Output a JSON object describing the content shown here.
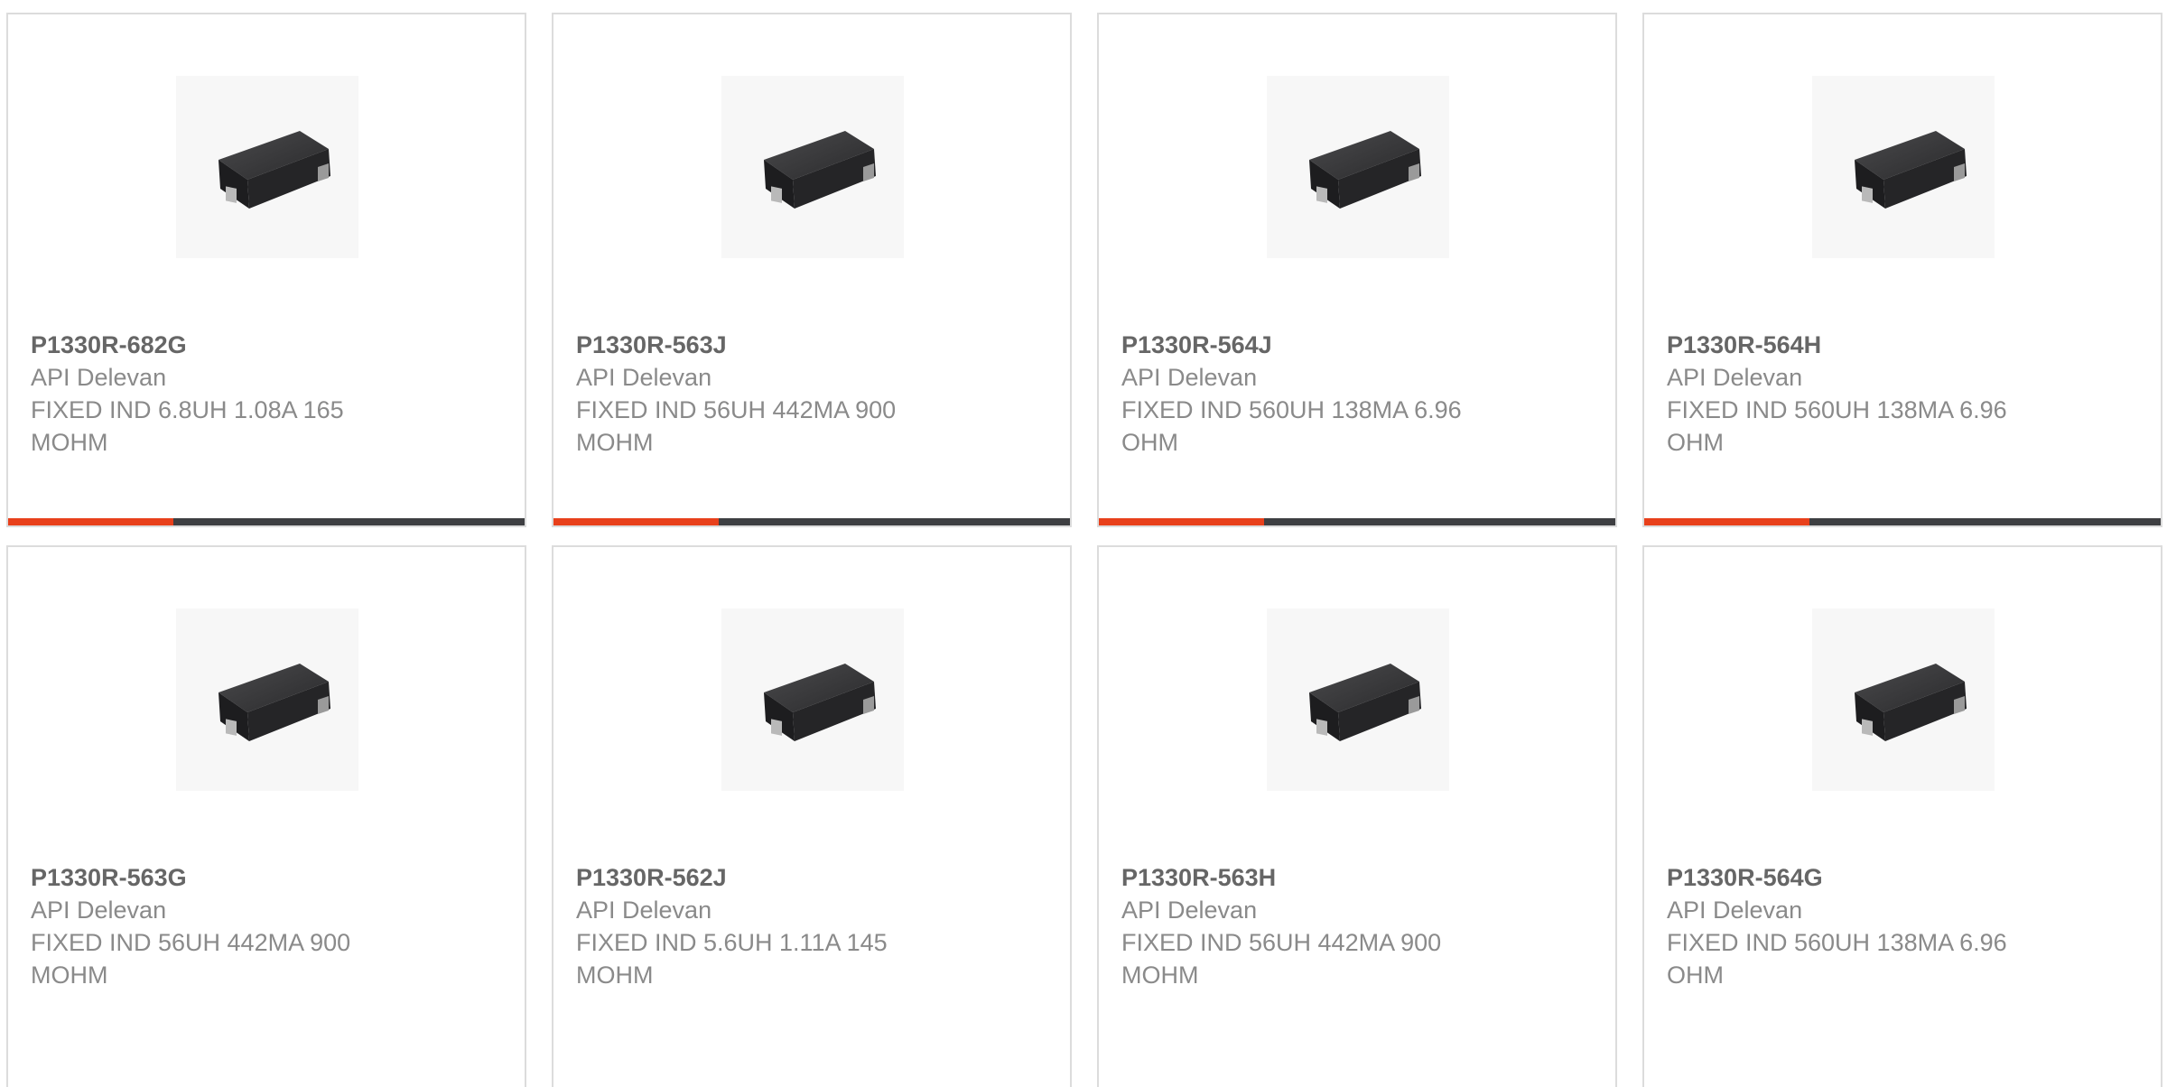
{
  "colors": {
    "accent": "#e8401b",
    "bar_dark": "#3e3f42",
    "border": "#dcdcdc",
    "part_text": "#666666",
    "body_text": "#8a8a8a"
  },
  "products": [
    {
      "part": "P1330R-682G",
      "manufacturer": "API Delevan",
      "description": "FIXED IND 6.8UH 1.08A 165 MOHM",
      "image_icon": "inductor-component-image"
    },
    {
      "part": "P1330R-563J",
      "manufacturer": "API Delevan",
      "description": "FIXED IND 56UH 442MA 900 MOHM",
      "image_icon": "inductor-component-image"
    },
    {
      "part": "P1330R-564J",
      "manufacturer": "API Delevan",
      "description": "FIXED IND 560UH 138MA 6.96 OHM",
      "image_icon": "inductor-component-image"
    },
    {
      "part": "P1330R-564H",
      "manufacturer": "API Delevan",
      "description": "FIXED IND 560UH 138MA 6.96 OHM",
      "image_icon": "inductor-component-image"
    },
    {
      "part": "P1330R-563G",
      "manufacturer": "API Delevan",
      "description": "FIXED IND 56UH 442MA 900 MOHM",
      "image_icon": "inductor-component-image"
    },
    {
      "part": "P1330R-562J",
      "manufacturer": "API Delevan",
      "description": "FIXED IND 5.6UH 1.11A 145 MOHM",
      "image_icon": "inductor-component-image"
    },
    {
      "part": "P1330R-563H",
      "manufacturer": "API Delevan",
      "description": "FIXED IND 56UH 442MA 900 MOHM",
      "image_icon": "inductor-component-image"
    },
    {
      "part": "P1330R-564G",
      "manufacturer": "API Delevan",
      "description": "FIXED IND 560UH 138MA 6.96 OHM",
      "image_icon": "inductor-component-image"
    }
  ],
  "carousel_progress": 0.32
}
